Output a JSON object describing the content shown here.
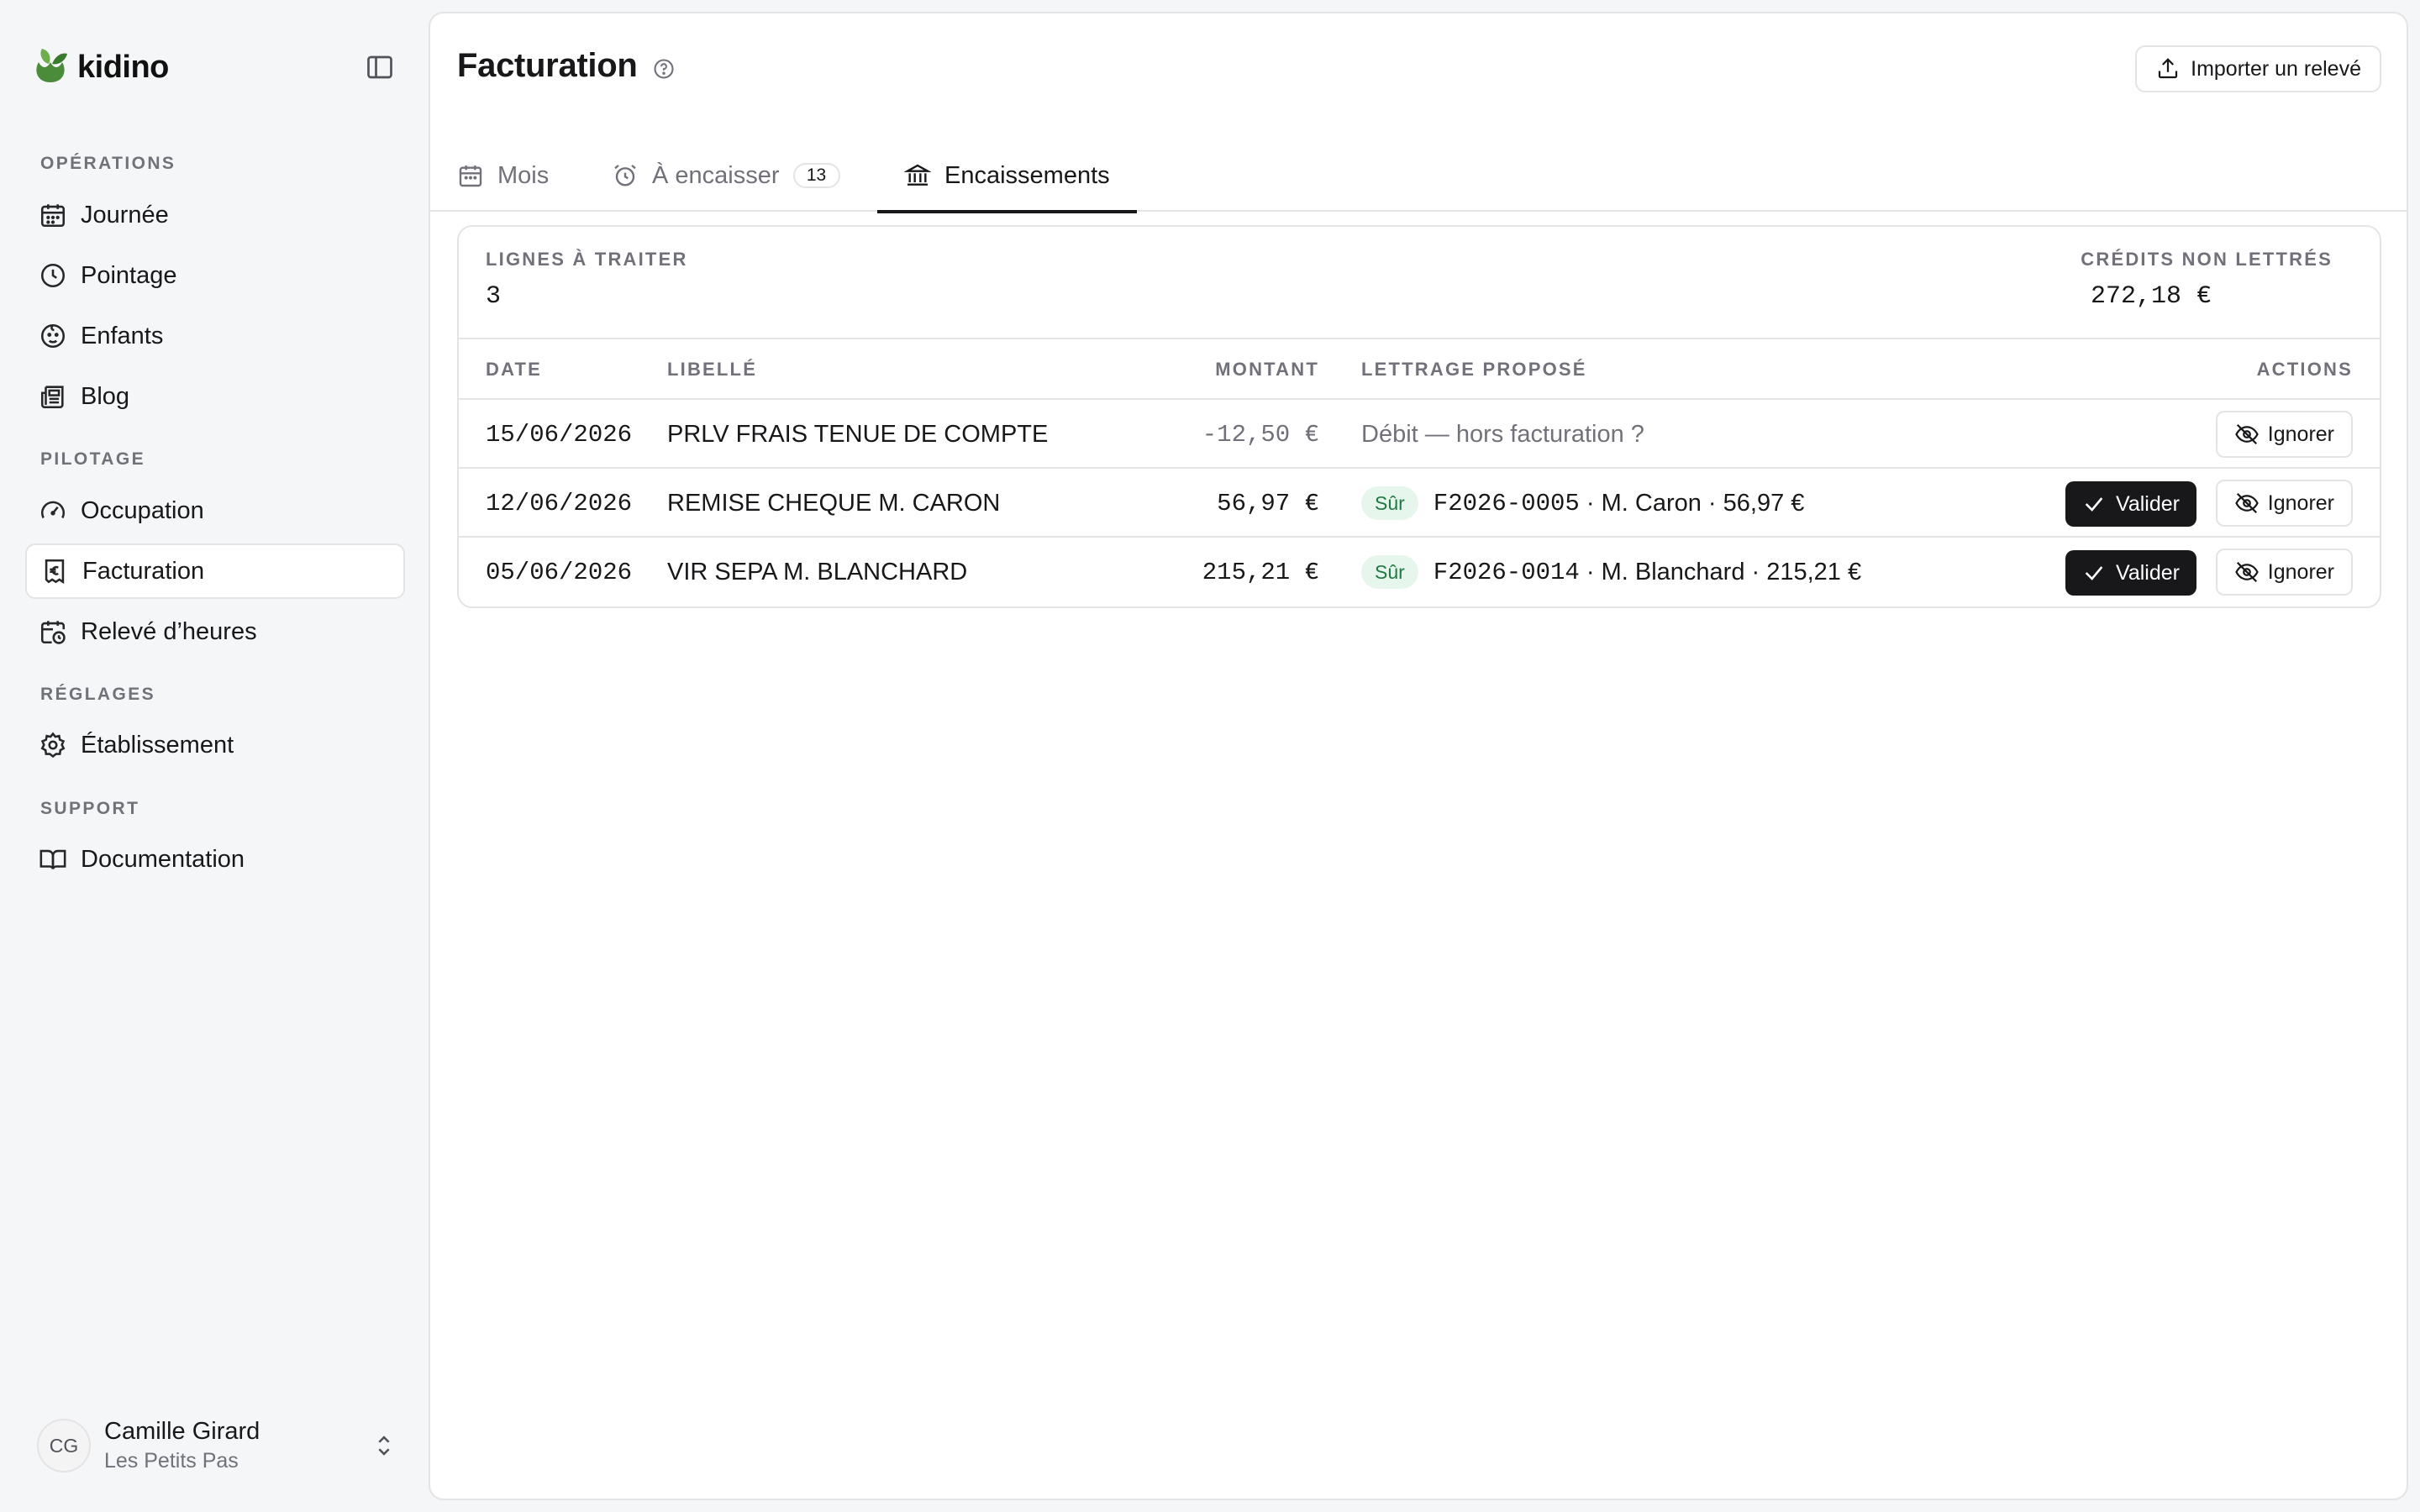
{
  "brand": {
    "name": "kidino"
  },
  "sidebar": {
    "sections": [
      {
        "label": "OPÉRATIONS",
        "items": [
          {
            "label": "Journée",
            "icon": "calendar-icon"
          },
          {
            "label": "Pointage",
            "icon": "clock-icon"
          },
          {
            "label": "Enfants",
            "icon": "child-face-icon"
          },
          {
            "label": "Blog",
            "icon": "newspaper-icon"
          }
        ]
      },
      {
        "label": "PILOTAGE",
        "items": [
          {
            "label": "Occupation",
            "icon": "gauge-icon"
          },
          {
            "label": "Facturation",
            "icon": "invoice-euro-icon",
            "active": true
          },
          {
            "label": "Relevé d’heures",
            "icon": "calendar-clock-icon"
          }
        ]
      },
      {
        "label": "RÉGLAGES",
        "items": [
          {
            "label": "Établissement",
            "icon": "gear-icon"
          }
        ]
      },
      {
        "label": "SUPPORT",
        "items": [
          {
            "label": "Documentation",
            "icon": "book-icon"
          }
        ]
      }
    ]
  },
  "user": {
    "initials": "CG",
    "name": "Camille Girard",
    "org": "Les Petits Pas"
  },
  "header": {
    "title": "Facturation",
    "import_label": "Importer un relevé"
  },
  "tabs": [
    {
      "label": "Mois",
      "icon": "calendar-icon"
    },
    {
      "label": "À encaisser",
      "icon": "alarm-clock-icon",
      "badge": "13"
    },
    {
      "label": "Encaissements",
      "icon": "bank-icon",
      "active": true
    }
  ],
  "summary": {
    "pending_label": "LIGNES À TRAITER",
    "pending_value": "3",
    "credits_label": "CRÉDITS NON LETTRÉS",
    "credits_value": "272,18 €"
  },
  "table": {
    "columns": [
      "DATE",
      "LIBELLÉ",
      "MONTANT",
      "LETTRAGE PROPOSÉ",
      "ACTIONS"
    ],
    "rows": [
      {
        "date": "15/06/2026",
        "label": "PRLV FRAIS TENUE DE COMPTE",
        "amount": "-12,50 €",
        "amount_muted": true,
        "confidence": "",
        "match": "Débit — hors facturation ?",
        "match_muted": true,
        "can_validate": false
      },
      {
        "date": "12/06/2026",
        "label": "REMISE CHEQUE M. CARON",
        "amount": "56,97 €",
        "amount_muted": false,
        "confidence": "Sûr",
        "match_ref": "F2026-0005",
        "match": " · M. Caron · 56,97 €",
        "match_muted": false,
        "can_validate": true
      },
      {
        "date": "05/06/2026",
        "label": "VIR SEPA M. BLANCHARD",
        "amount": "215,21 €",
        "amount_muted": false,
        "confidence": "Sûr",
        "match_ref": "F2026-0014",
        "match": " · M. Blanchard · 215,21 €",
        "match_muted": false,
        "can_validate": true
      }
    ],
    "validate_label": "Valider",
    "ignore_label": "Ignorer"
  },
  "colors": {
    "accent": "#18181b",
    "sure_badge_bg": "#e7f6ec",
    "sure_badge_text": "#1f7a41",
    "logo_green": "#4a8c3a"
  }
}
